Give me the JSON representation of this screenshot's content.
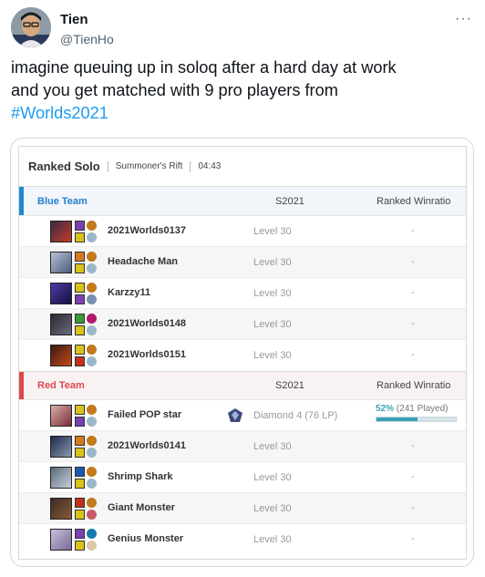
{
  "tweet": {
    "display_name": "Tien",
    "handle": "@TienHo",
    "more_icon": "···",
    "text_line1": "imagine queuing up in soloq after a hard day at work",
    "text_line2": "and you get matched with 9 pro players from",
    "hashtag": "#Worlds2021"
  },
  "match": {
    "queue": "Ranked Solo",
    "map": "Summoner's Rift",
    "duration": "04:43",
    "season_col": "S2021",
    "winratio_col": "Ranked Winratio",
    "blue_team": {
      "name": "Blue Team",
      "color": "#1f8ad1",
      "players": [
        {
          "name": "2021Worlds0137",
          "level": "Level 30",
          "winratio": "-",
          "champ_colors": [
            "#3b2a4a",
            "#c23b22"
          ],
          "spells": [
            "#7a3fb0",
            "#d9c21a"
          ],
          "runes": [
            "#c27a1a",
            "#9ab8c8"
          ]
        },
        {
          "name": "Headache Man",
          "level": "Level 30",
          "winratio": "-",
          "champ_colors": [
            "#b9c3d6",
            "#4d5a7a"
          ],
          "spells": [
            "#d67a1f",
            "#d9c21a"
          ],
          "runes": [
            "#c27a1a",
            "#9ab8c8"
          ]
        },
        {
          "name": "Karzzy11",
          "level": "Level 30",
          "winratio": "-",
          "champ_colors": [
            "#4b3aa8",
            "#161040"
          ],
          "spells": [
            "#d9c21a",
            "#7a3fb0"
          ],
          "runes": [
            "#c27a1a",
            "#7a8fb0"
          ]
        },
        {
          "name": "2021Worlds0148",
          "level": "Level 30",
          "winratio": "-",
          "champ_colors": [
            "#2a2a33",
            "#6b6b7a"
          ],
          "spells": [
            "#3a9a3a",
            "#d9c21a"
          ],
          "runes": [
            "#b01a6a",
            "#9ab8c8"
          ]
        },
        {
          "name": "2021Worlds0151",
          "level": "Level 30",
          "winratio": "-",
          "champ_colors": [
            "#3a1a12",
            "#c24a1a"
          ],
          "spells": [
            "#d9c21a",
            "#c2301a"
          ],
          "runes": [
            "#c27a1a",
            "#9ab8c8"
          ]
        }
      ]
    },
    "red_team": {
      "name": "Red Team",
      "color": "#e2464c",
      "players": [
        {
          "name": "Failed POP star",
          "level": "Diamond 4 (76 LP)",
          "ranked": true,
          "winrate_pct": "52%",
          "played": "(241 Played)",
          "winrate_value": 52,
          "champ_colors": [
            "#d8b0a8",
            "#7a2a3a"
          ],
          "spells": [
            "#d9c21a",
            "#7a3fb0"
          ],
          "runes": [
            "#c27a1a",
            "#9ab8c8"
          ]
        },
        {
          "name": "2021Worlds0141",
          "level": "Level 30",
          "winratio": "-",
          "champ_colors": [
            "#1a2a4a",
            "#8a9ab0"
          ],
          "spells": [
            "#d67a1f",
            "#d9c21a"
          ],
          "runes": [
            "#c27a1a",
            "#9ab8c8"
          ]
        },
        {
          "name": "Shrimp Shark",
          "level": "Level 30",
          "winratio": "-",
          "champ_colors": [
            "#5a6a7a",
            "#c8d0d8"
          ],
          "spells": [
            "#1a5ab0",
            "#d9c21a"
          ],
          "runes": [
            "#c27a1a",
            "#9ab8c8"
          ]
        },
        {
          "name": "Giant Monster",
          "level": "Level 30",
          "winratio": "-",
          "champ_colors": [
            "#3a2a22",
            "#8a5a3a"
          ],
          "spells": [
            "#c2301a",
            "#d9c21a"
          ],
          "runes": [
            "#c27a1a",
            "#c85a6a"
          ]
        },
        {
          "name": "Genius Monster",
          "level": "Level 30",
          "winratio": "-",
          "champ_colors": [
            "#c8c0d8",
            "#7a6a9a"
          ],
          "spells": [
            "#7a3fb0",
            "#d9c21a"
          ],
          "runes": [
            "#1a7ab0",
            "#d8c8a8"
          ]
        }
      ]
    }
  }
}
